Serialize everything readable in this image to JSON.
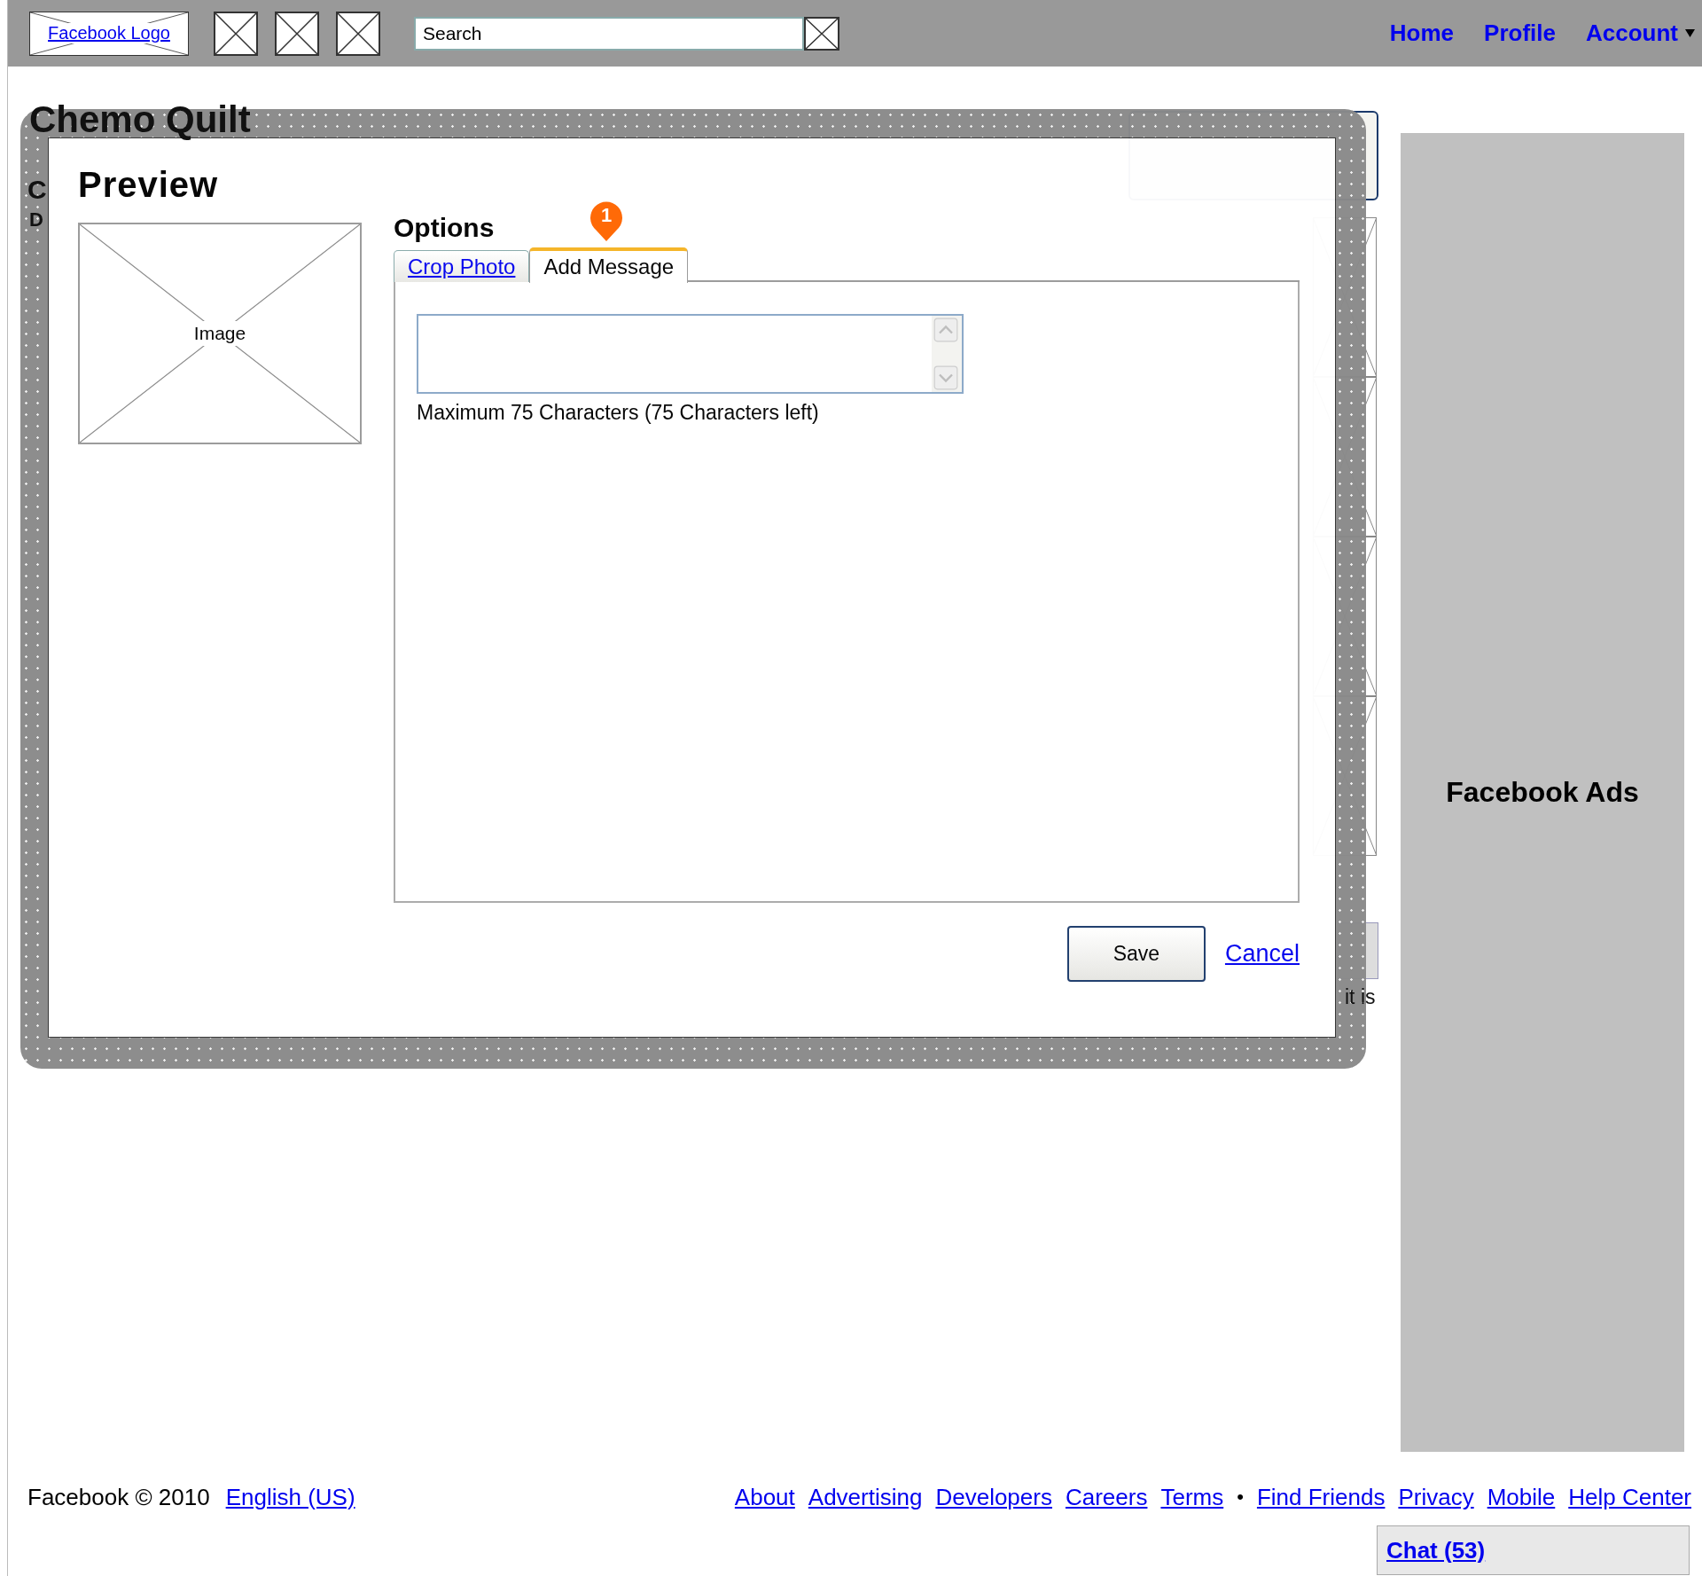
{
  "topbar": {
    "logo": "Facebook Logo",
    "search": {
      "placeholder": "Search"
    },
    "nav": [
      {
        "label": "Home",
        "has_menu": false
      },
      {
        "label": "Profile",
        "has_menu": false
      },
      {
        "label": "Account",
        "has_menu": true
      }
    ]
  },
  "page": {
    "title": "Chemo Quilt",
    "fragments": [
      "C",
      "D",
      "it is"
    ]
  },
  "dialog": {
    "title": "Preview",
    "image_label": "Image",
    "options_title": "Options",
    "callout": "1",
    "tabs": [
      {
        "label": "Crop Photo",
        "selected": false
      },
      {
        "label": "Add Message",
        "selected": true
      }
    ],
    "hint": "Maximum 75 Characters (75 Characters left)",
    "actions": [
      {
        "label": "Save",
        "kind": "button"
      },
      {
        "label": "Cancel",
        "kind": "link"
      }
    ]
  },
  "ads": {
    "label": "Facebook Ads"
  },
  "footer": {
    "copyright": "Facebook © 2010",
    "language": "English (US)",
    "links": [
      {
        "label": "About",
        "kind": "link"
      },
      {
        "label": "Advertising",
        "kind": "link"
      },
      {
        "label": "Developers",
        "kind": "link"
      },
      {
        "label": "Careers",
        "kind": "link"
      },
      {
        "label": "Terms",
        "kind": "link"
      },
      {
        "label": "•",
        "kind": "separator"
      },
      {
        "label": "Find Friends",
        "kind": "link"
      },
      {
        "label": "Privacy",
        "kind": "link"
      },
      {
        "label": "Mobile",
        "kind": "link"
      },
      {
        "label": "Help Center",
        "kind": "link"
      }
    ]
  },
  "chat": {
    "label": "Chat (53)"
  }
}
